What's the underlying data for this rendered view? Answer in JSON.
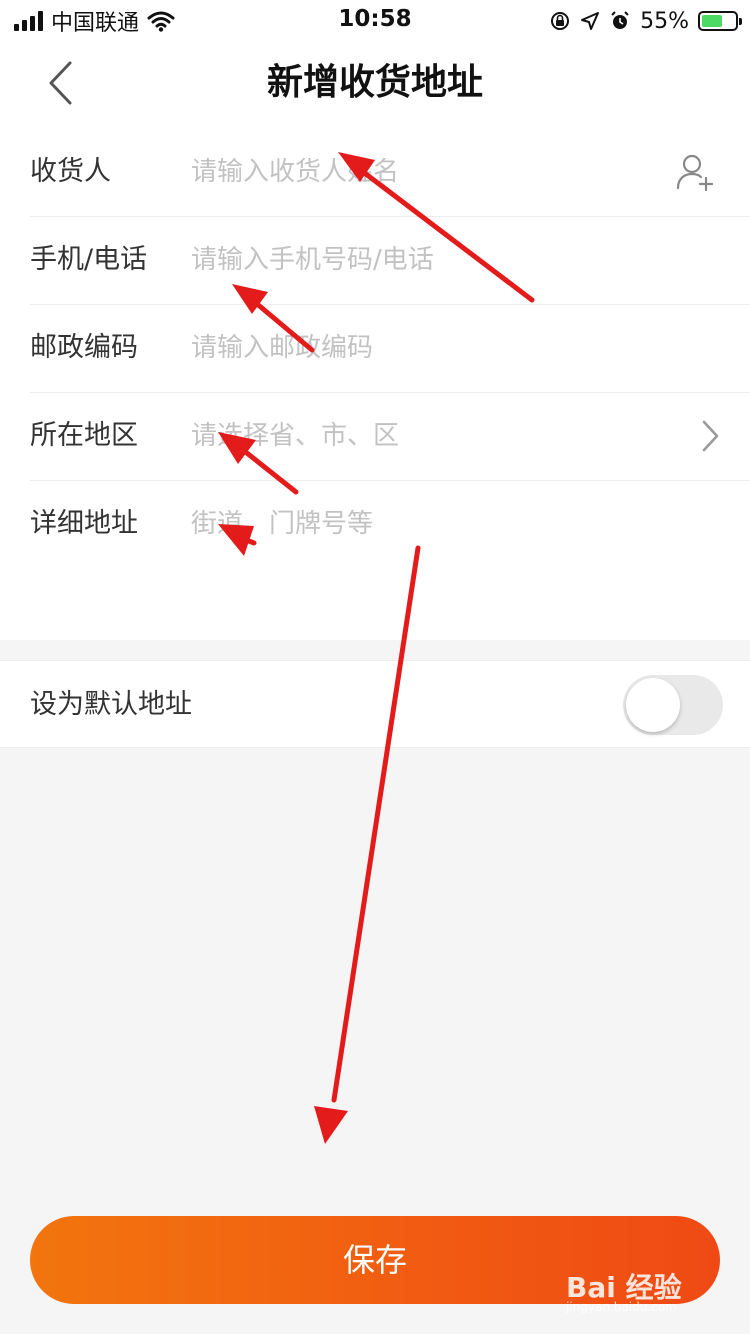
{
  "status_bar": {
    "carrier": "中国联通",
    "time": "10:58",
    "battery": "55%"
  },
  "header": {
    "title": "新增收货地址"
  },
  "form": {
    "receiver": {
      "label": "收货人",
      "placeholder": "请输入收货人姓名"
    },
    "phone": {
      "label": "手机/电话",
      "placeholder": "请输入手机号码/电话"
    },
    "zip": {
      "label": "邮政编码",
      "placeholder": "请输入邮政编码"
    },
    "region": {
      "label": "所在地区",
      "placeholder": "请选择省、市、区"
    },
    "detail": {
      "label": "详细地址",
      "placeholder": "街道、门牌号等"
    }
  },
  "default_address": {
    "label": "设为默认地址",
    "enabled": false
  },
  "save_button": {
    "label": "保存"
  },
  "watermark": {
    "text": "Bai 经验",
    "subtext": "jingyan.baidu.com"
  },
  "colors": {
    "accent_start": "#f2750e",
    "accent_end": "#ef4a14",
    "annotation_arrow": "#e41b1b",
    "placeholder": "#c2c2c2"
  }
}
